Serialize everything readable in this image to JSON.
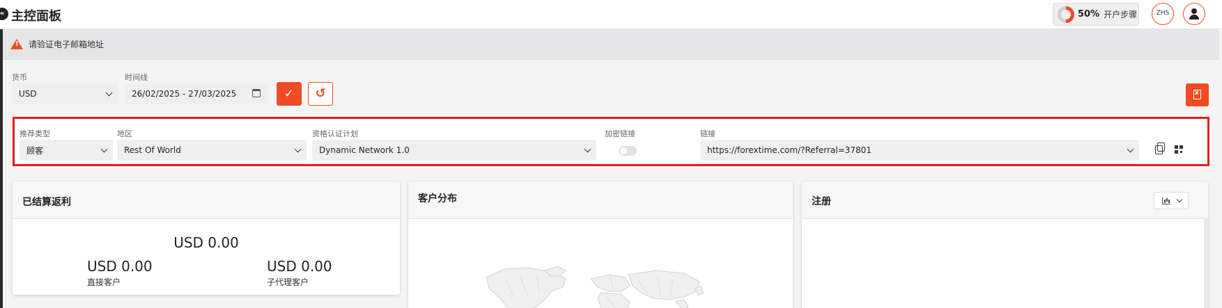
{
  "header": {
    "back_icon": "double-chevron-left-icon",
    "title": "主控面板",
    "progress": {
      "percent_label": "50%",
      "fraction": 0.5,
      "label": "开户步骤"
    },
    "language": "ZHS",
    "user_icon": "user-icon"
  },
  "alert": {
    "icon": "warning-icon",
    "text": "请验证电子邮箱地址"
  },
  "filters": {
    "currency": {
      "label": "货币",
      "value": "USD"
    },
    "timeline": {
      "label": "时间线",
      "value": "26/02/2025 - 27/03/2025"
    },
    "apply_icon": "check-icon",
    "reset_icon": "undo-icon",
    "export_icon": "excel-export-icon"
  },
  "referral": {
    "type": {
      "label": "推荐类型",
      "value": "顾客"
    },
    "region": {
      "label": "地区",
      "value": "Rest Of World"
    },
    "plan": {
      "label": "资格认证计划",
      "value": "Dynamic Network 1.0"
    },
    "encrypted": {
      "label": "加密链接",
      "enabled": false
    },
    "link": {
      "label": "链接",
      "value": "https://forextime.com/?Referral=37801"
    }
  },
  "cards": {
    "rebates": {
      "title": "已结算返利",
      "total": "USD 0.00",
      "direct_value": "USD 0.00",
      "direct_label": "直接客户",
      "sub_value": "USD 0.00",
      "sub_label": "子代理客户"
    },
    "distribution": {
      "title": "客户分布"
    },
    "registrations": {
      "title": "注册",
      "chart_icon": "bar-chart-icon"
    }
  },
  "colors": {
    "accent": "#f04b24",
    "highlight_border": "#e11d22"
  }
}
